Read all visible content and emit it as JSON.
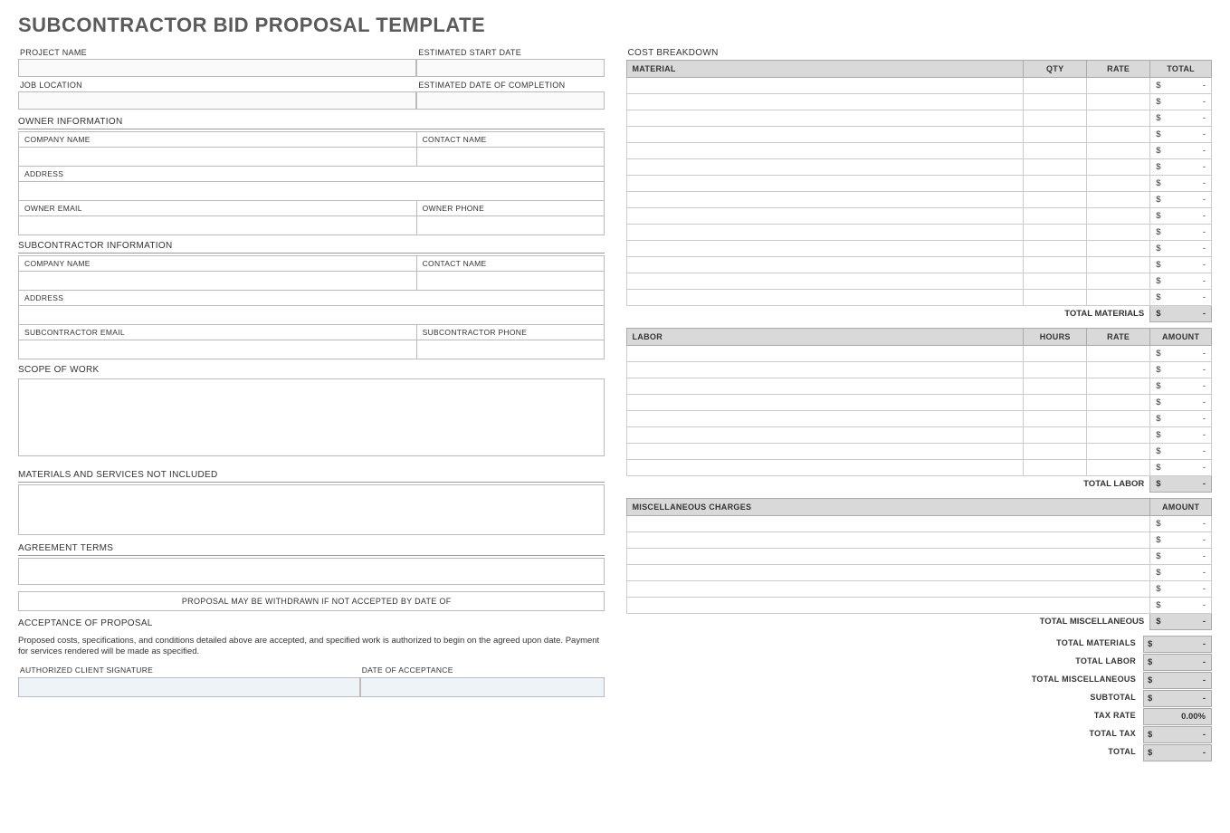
{
  "title": "SUBCONTRACTOR BID PROPOSAL TEMPLATE",
  "left": {
    "project_name_label": "PROJECT NAME",
    "start_date_label": "ESTIMATED START DATE",
    "job_location_label": "JOB LOCATION",
    "completion_date_label": "ESTIMATED DATE OF COMPLETION",
    "owner_info_label": "OWNER INFORMATION",
    "company_name_label": "COMPANY NAME",
    "contact_name_label": "CONTACT NAME",
    "address_label": "ADDRESS",
    "owner_email_label": "OWNER EMAIL",
    "owner_phone_label": "OWNER PHONE",
    "sub_info_label": "SUBCONTRACTOR INFORMATION",
    "sub_email_label": "SUBCONTRACTOR EMAIL",
    "sub_phone_label": "SUBCONTRACTOR PHONE",
    "scope_label": "SCOPE OF WORK",
    "not_included_label": "MATERIALS AND SERVICES NOT INCLUDED",
    "agreement_label": "AGREEMENT TERMS",
    "withdraw_label": "PROPOSAL MAY BE WITHDRAWN IF NOT ACCEPTED BY DATE OF",
    "acceptance_label": "ACCEPTANCE OF PROPOSAL",
    "acceptance_text": "Proposed costs, specifications, and conditions detailed above are accepted, and specified work is authorized to begin on the agreed upon date.  Payment for services rendered will be made as specified.",
    "sig_label": "AUTHORIZED CLIENT SIGNATURE",
    "date_accept_label": "DATE OF ACCEPTANCE"
  },
  "right": {
    "cost_breakdown_label": "COST BREAKDOWN",
    "material_hdr": "MATERIAL",
    "qty_hdr": "QTY",
    "rate_hdr": "RATE",
    "total_hdr": "TOTAL",
    "labor_hdr": "LABOR",
    "hours_hdr": "HOURS",
    "amount_hdr": "AMOUNT",
    "misc_hdr": "MISCELLANEOUS CHARGES",
    "total_materials_label": "TOTAL MATERIALS",
    "total_labor_label": "TOTAL LABOR",
    "total_misc_label": "TOTAL MISCELLANEOUS",
    "subtotal_label": "SUBTOTAL",
    "tax_rate_label": "TAX RATE",
    "total_tax_label": "TOTAL TAX",
    "grand_total_label": "TOTAL",
    "currency": "$",
    "dash": "-",
    "tax_rate_value": "0.00%",
    "material_rows": 14,
    "labor_rows": 8,
    "misc_rows": 6
  }
}
